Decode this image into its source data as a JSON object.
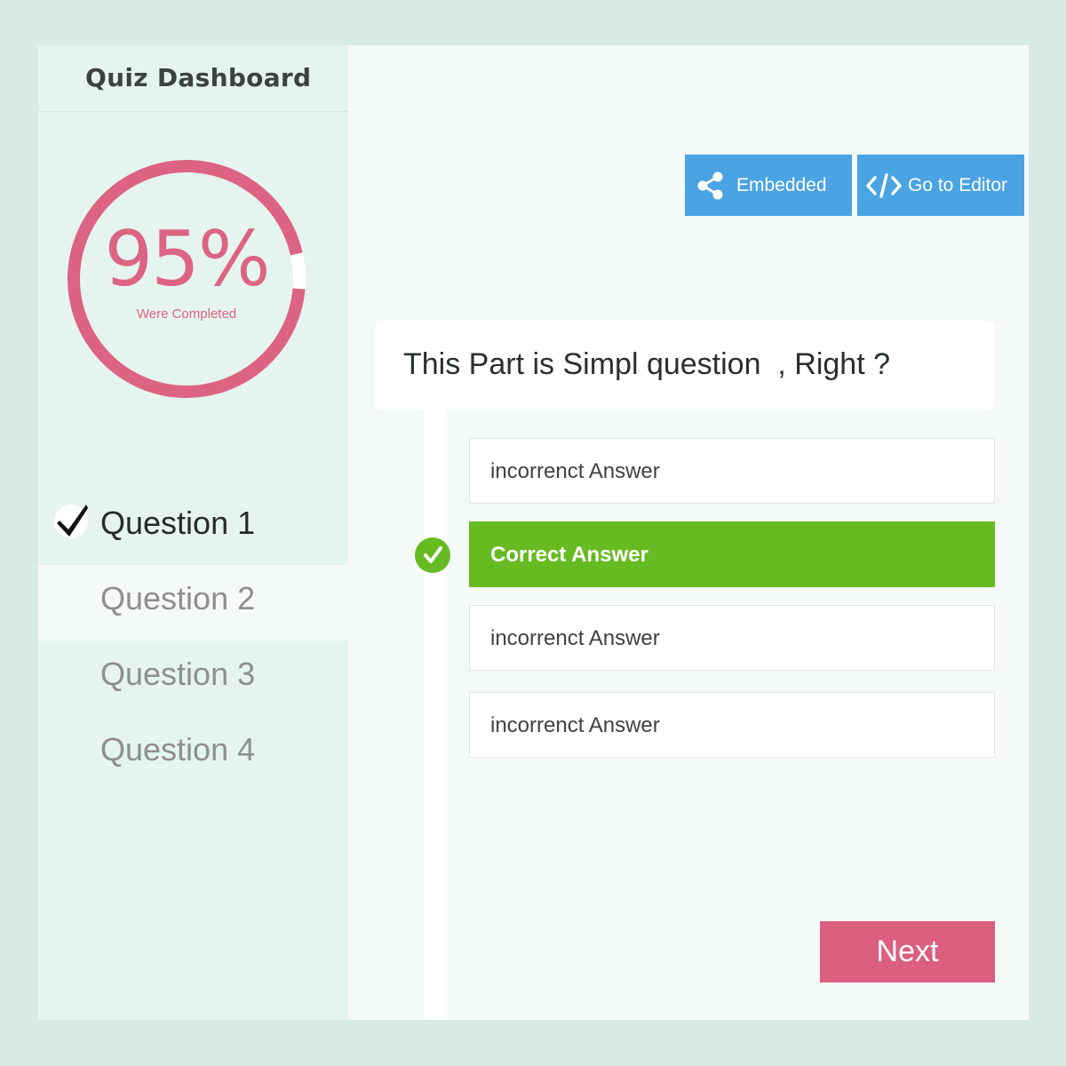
{
  "sidebar": {
    "title": "Quiz Dashboard",
    "progress": {
      "value_text": "95%",
      "fraction": 0.95,
      "caption": "Were Completed",
      "color": "#dc6384"
    },
    "questions": [
      {
        "label": "Question 1",
        "completed": true
      },
      {
        "label": "Question 2",
        "completed": false,
        "selected": true
      },
      {
        "label": "Question 3",
        "completed": false
      },
      {
        "label": "Question 4",
        "completed": false
      }
    ]
  },
  "toolbar": {
    "embedded_label": "Embedded",
    "embedded_icon": "share-icon",
    "editor_label": "Go to Editor",
    "editor_icon": "code-icon",
    "button_color": "#4aa3e2"
  },
  "question": {
    "text": "This Part is Simpl question  , Right ?",
    "answers": [
      {
        "label": "incorrenct Answer",
        "correct": false
      },
      {
        "label": "Correct Answer",
        "correct": true
      },
      {
        "label": "incorrenct Answer",
        "correct": false
      },
      {
        "label": "incorrenct Answer",
        "correct": false
      }
    ],
    "correct_color": "#67bb22"
  },
  "next_label": "Next",
  "next_color": "#dc5f80"
}
